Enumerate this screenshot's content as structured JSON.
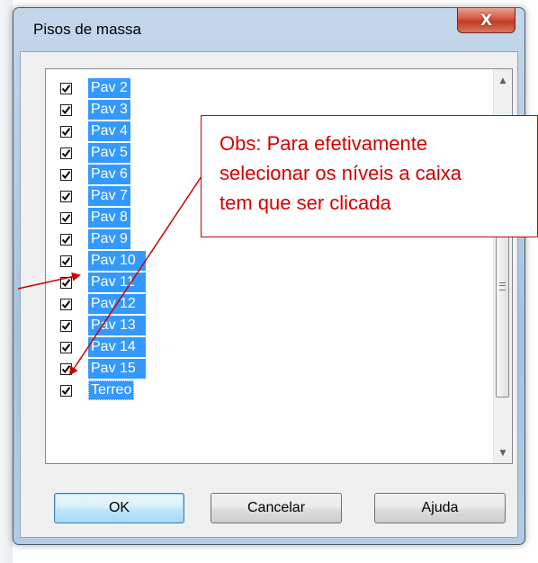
{
  "window": {
    "title": "Pisos de massa",
    "close_glyph": "X"
  },
  "list": {
    "items": [
      {
        "label": "Pav 2",
        "checked": true,
        "selected": true
      },
      {
        "label": "Pav 3",
        "checked": true,
        "selected": true
      },
      {
        "label": "Pav 4",
        "checked": true,
        "selected": true
      },
      {
        "label": "Pav 5",
        "checked": true,
        "selected": true
      },
      {
        "label": "Pav 6",
        "checked": true,
        "selected": true
      },
      {
        "label": "Pav 7",
        "checked": true,
        "selected": true
      },
      {
        "label": "Pav 8",
        "checked": true,
        "selected": true
      },
      {
        "label": "Pav 9",
        "checked": true,
        "selected": true
      },
      {
        "label": "Pav 10",
        "checked": true,
        "selected": true
      },
      {
        "label": "Pav 11",
        "checked": true,
        "selected": true
      },
      {
        "label": "Pav 12",
        "checked": true,
        "selected": true
      },
      {
        "label": "Pav 13",
        "checked": true,
        "selected": true
      },
      {
        "label": "Pav 14",
        "checked": true,
        "selected": true
      },
      {
        "label": "Pav 15",
        "checked": true,
        "selected": true
      },
      {
        "label": "Terreo",
        "checked": true,
        "selected": true,
        "focused": true
      }
    ],
    "scroll_up_icon": "scroll-up-arrow-icon",
    "scroll_down_icon": "scroll-down-arrow-icon"
  },
  "buttons": {
    "ok": "OK",
    "cancel": "Cancelar",
    "help": "Ajuda"
  },
  "annotation": {
    "line1": "Obs: Para efetivamente",
    "line2": "selecionar os níveis a caixa",
    "line3": "tem que ser clicada"
  },
  "colors": {
    "selection": "#3399ff",
    "annotation": "#cc0000",
    "ok_button_border": "#3c7fb1"
  }
}
